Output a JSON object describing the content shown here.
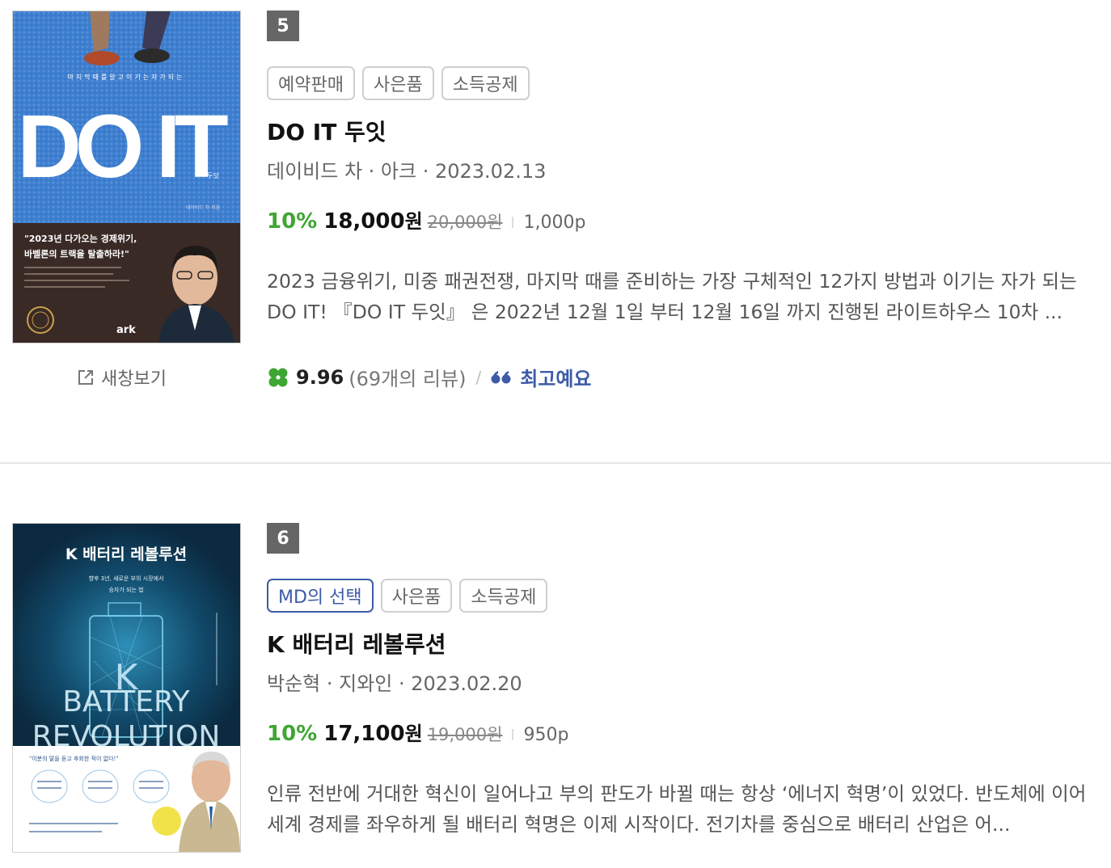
{
  "items": [
    {
      "rank": "5",
      "tags": [
        "예약판매",
        "사은품",
        "소득공제"
      ],
      "title": "DO IT 두잇",
      "meta": "데이비드 차 · 아크 · 2023.02.13",
      "discount": "10%",
      "sale_price": "18,000",
      "won": "원",
      "original_price": "20,000원",
      "points": "1,000p",
      "description": "2023 금융위기, 미중 패권전쟁, 마지막 때를 준비하는 가장 구체적인 12가지 방법과 이기는 자가 되는 DO IT! 『DO IT 두잇』 은 2022년 12월 1일 부터 12월 16일 까지 진행된 라이트하우스 10차 ...",
      "rating": "9.96",
      "review_count": "(69개의 리뷰)",
      "review_label": "최고예요",
      "new_window": "새창보기",
      "cover": {
        "top_text": "마지막때를알고이기는자가되는",
        "big_title": "DO IT",
        "small_label": "두잇",
        "author_small": "데이비드 차 지음",
        "quote": "\"2023년 다가오는 경제위기,",
        "quote2": "바벨론의 트랙을 탈출하라!\"",
        "publisher_logo": "ark"
      }
    },
    {
      "rank": "6",
      "tags": [
        "MD의 선택",
        "사은품",
        "소득공제"
      ],
      "title": "K 배터리 레볼루션",
      "meta": "박순혁 · 지와인 · 2023.02.20",
      "discount": "10%",
      "sale_price": "17,100",
      "won": "원",
      "original_price": "19,000원",
      "points": "950p",
      "description": "인류 전반에 거대한 혁신이 일어나고 부의 판도가 바뀔 때는 항상 ‘에너지 혁명’이 있었다. 반도체에 이어 세계 경제를 좌우하게 될 배터리 혁명은 이제 시작이다. 전기차를 중심으로 배터리 산업은 어...",
      "cover": {
        "title": "K 배터리 레볼루션",
        "subtitle1": "향후 3년, 새로운 부의 시장에서",
        "subtitle2": "승자가 되는 법",
        "battery_word": "BATTERY",
        "revolution_word": "REVOLUTION",
        "bottom_quote": "\"이분의 말을 듣고 후회한 적이 없다!\""
      }
    }
  ],
  "colors": {
    "discount": "#3ea632",
    "accent": "#3d5ba9",
    "rank_bg": "#666666"
  }
}
